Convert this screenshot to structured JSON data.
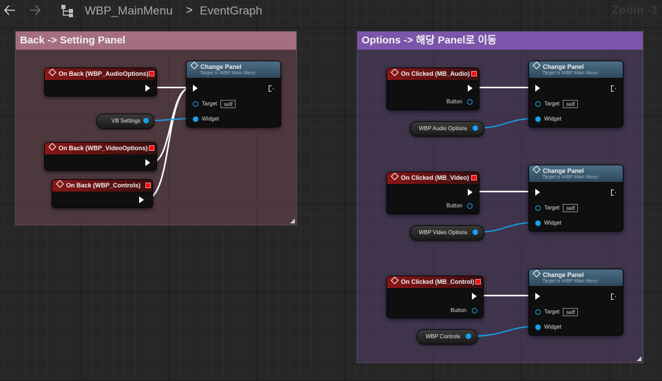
{
  "toolbar": {
    "back_icon": "arrow-left-icon",
    "forward_icon": "arrow-right-icon",
    "graph_icon": "graph-hierarchy-icon",
    "breadcrumb_asset": "WBP_MainMenu",
    "breadcrumb_separator": ">",
    "breadcrumb_graph": "EventGraph",
    "zoom_label": "Zoom -3"
  },
  "comments": {
    "back": {
      "title": "Back -> Setting Panel",
      "color": "#a56f7f"
    },
    "options": {
      "title": "Options -> 해당 Panel로 이동",
      "color": "#7b55a9"
    }
  },
  "nodes": {
    "back_audio": {
      "title": "On Back (WBP_AudioOptions)"
    },
    "back_video": {
      "title": "On Back (WBP_VideoOptions)"
    },
    "back_controls": {
      "title": "On Back (WBP_Controls)"
    },
    "vb_settings": {
      "label": "VB Settings"
    },
    "change_panel_back": {
      "title": "Change Panel",
      "subtitle": "Target is WBP Main Menu",
      "target_label": "Target",
      "target_value": "self",
      "widget_label": "Widget"
    },
    "click_audio": {
      "title": "On Clicked (MB_Audio)",
      "button_label": "Button"
    },
    "click_video": {
      "title": "On Clicked (MB_Video)",
      "button_label": "Button"
    },
    "click_control": {
      "title": "On Clicked (MB_Control)",
      "button_label": "Button"
    },
    "wbp_audio": {
      "label": "WBP Audio Options"
    },
    "wbp_video": {
      "label": "WBP Video Options"
    },
    "wbp_controls": {
      "label": "WBP Controls"
    },
    "change_panel_audio": {
      "title": "Change Panel",
      "subtitle": "Target is WBP Main Menu",
      "target_label": "Target",
      "target_value": "self",
      "widget_label": "Widget"
    },
    "change_panel_video": {
      "title": "Change Panel",
      "subtitle": "Target is WBP Main Menu",
      "target_label": "Target",
      "target_value": "self",
      "widget_label": "Widget"
    },
    "change_panel_control": {
      "title": "Change Panel",
      "subtitle": "Target is WBP Main Menu",
      "target_label": "Target",
      "target_value": "self",
      "widget_label": "Widget"
    }
  },
  "colors": {
    "exec_wire": "#ffffff",
    "object_wire": "#1aa0e8",
    "event_header": "#8a1717",
    "function_header": "#4b6f88"
  }
}
